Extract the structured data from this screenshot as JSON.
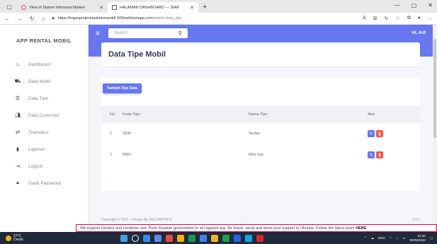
{
  "browser": {
    "tabs": [
      {
        "title": "View of Sistem Informasi Market",
        "active": false
      },
      {
        "title": "HALAMAN DASHBOARD — SIAP",
        "active": true
      }
    ],
    "url_domain": "https://tugasprojectuaskelompok6.000webhostapp.com",
    "url_path": "/admin/data_tipe"
  },
  "sidebar": {
    "brand": "APP RENTAL MOBIL",
    "items": [
      {
        "label": "Dashboard",
        "icon": "fire-icon"
      },
      {
        "label": "Data Mobil",
        "icon": "car-icon"
      },
      {
        "label": "Data Tipe",
        "icon": "list-icon"
      },
      {
        "label": "Data Customer",
        "icon": "users-icon"
      },
      {
        "label": "Transaksi",
        "icon": "random-icon"
      },
      {
        "label": "Laporan",
        "icon": "clipboard-icon"
      },
      {
        "label": "Logout",
        "icon": "sign-out-icon"
      },
      {
        "label": "Ganti Password",
        "icon": "lock-icon"
      }
    ]
  },
  "topnav": {
    "search_placeholder": "Search",
    "user": "Hi, Arif"
  },
  "page": {
    "title": "Data Tipe Mobil",
    "add_button": "Tambah Tipe Data"
  },
  "table": {
    "headers": [
      "No",
      "Kode Tipe",
      "Nama Tipe",
      "Aksi"
    ],
    "rows": [
      {
        "no": "1",
        "kode": "SDN",
        "nama": "Sedan"
      },
      {
        "no": "2",
        "kode": "MNV",
        "nama": "Mini Van"
      }
    ]
  },
  "footer": {
    "copyright": "Copyright © 2021 • Design By KELOMPOK 6",
    "version": "2.3.0"
  },
  "banner": {
    "text": "We support Ukraine and condemn war. Push Russian government to act against war. Be brave, vocal and show your support to Ukraine. Follow the latest news",
    "link": "HERE"
  },
  "taskbar": {
    "temp": "27°C",
    "weather": "Cerah",
    "lang": "ENG",
    "time": "22:32",
    "date": "30/05/2022"
  },
  "colors": {
    "primary": "#6777ef",
    "danger": "#fc544b",
    "background": "#f4f6f9"
  }
}
